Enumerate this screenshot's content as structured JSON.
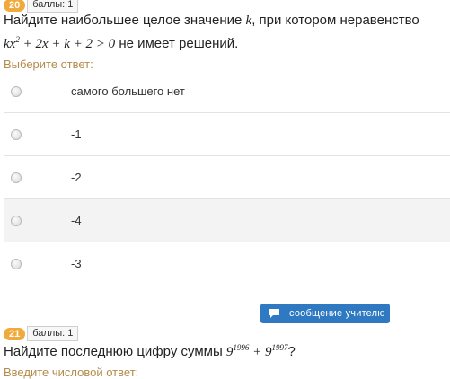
{
  "q20": {
    "number": "20",
    "points": "баллы: 1",
    "line1": "Найдите наибольшее целое значение",
    "k": "k",
    "line1_rest": ", при котором неравенство",
    "ineq_a": "kx",
    "ineq_sup": "2",
    "ineq_b": " + 2x + k + 2 > 0",
    "line2_rest": "не имеет решений.",
    "prompt": "Выберите ответ:",
    "options": [
      {
        "label": "самого большего нет"
      },
      {
        "label": "-1"
      },
      {
        "label": "-2"
      },
      {
        "label": "-4"
      },
      {
        "label": "-3"
      }
    ]
  },
  "message_button": {
    "label": "сообщение  учителю",
    "icon": "speech-bubble-icon"
  },
  "q21": {
    "number": "21",
    "points": "баллы: 1",
    "text": "Найдите последнюю цифру суммы",
    "base1": "9",
    "exp1": "1996",
    "plus": " + ",
    "base2": "9",
    "exp2": "1997",
    "end": "?",
    "prompt_partial": "Введите числовой ответ:"
  },
  "colors": {
    "badge": "#f0a93a",
    "prompt": "#b38a4a",
    "button": "#2e79c2"
  }
}
